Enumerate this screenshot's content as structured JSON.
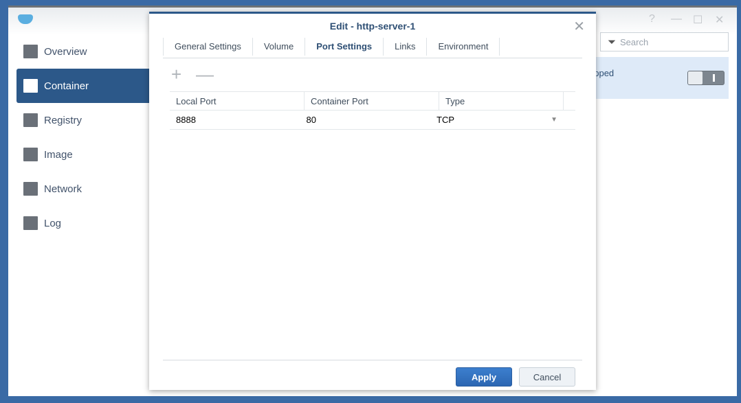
{
  "window": {
    "controls": [
      "?",
      "—",
      "☐",
      "✕"
    ]
  },
  "sidebar": {
    "items": [
      {
        "label": "Overview",
        "icon": "overview-icon"
      },
      {
        "label": "Container",
        "icon": "container-icon",
        "active": true
      },
      {
        "label": "Registry",
        "icon": "registry-icon"
      },
      {
        "label": "Image",
        "icon": "image-icon"
      },
      {
        "label": "Network",
        "icon": "network-icon"
      },
      {
        "label": "Log",
        "icon": "log-icon"
      }
    ]
  },
  "search": {
    "placeholder": "Search"
  },
  "container_row": {
    "status": "opped"
  },
  "dialog": {
    "title": "Edit - http-server-1",
    "tabs": [
      "General Settings",
      "Volume",
      "Port Settings",
      "Links",
      "Environment"
    ],
    "active_tab": "Port Settings",
    "columns": [
      "Local Port",
      "Container Port",
      "Type"
    ],
    "rows": [
      {
        "local": "8888",
        "container": "80",
        "type": "TCP"
      }
    ],
    "apply": "Apply",
    "cancel": "Cancel"
  }
}
